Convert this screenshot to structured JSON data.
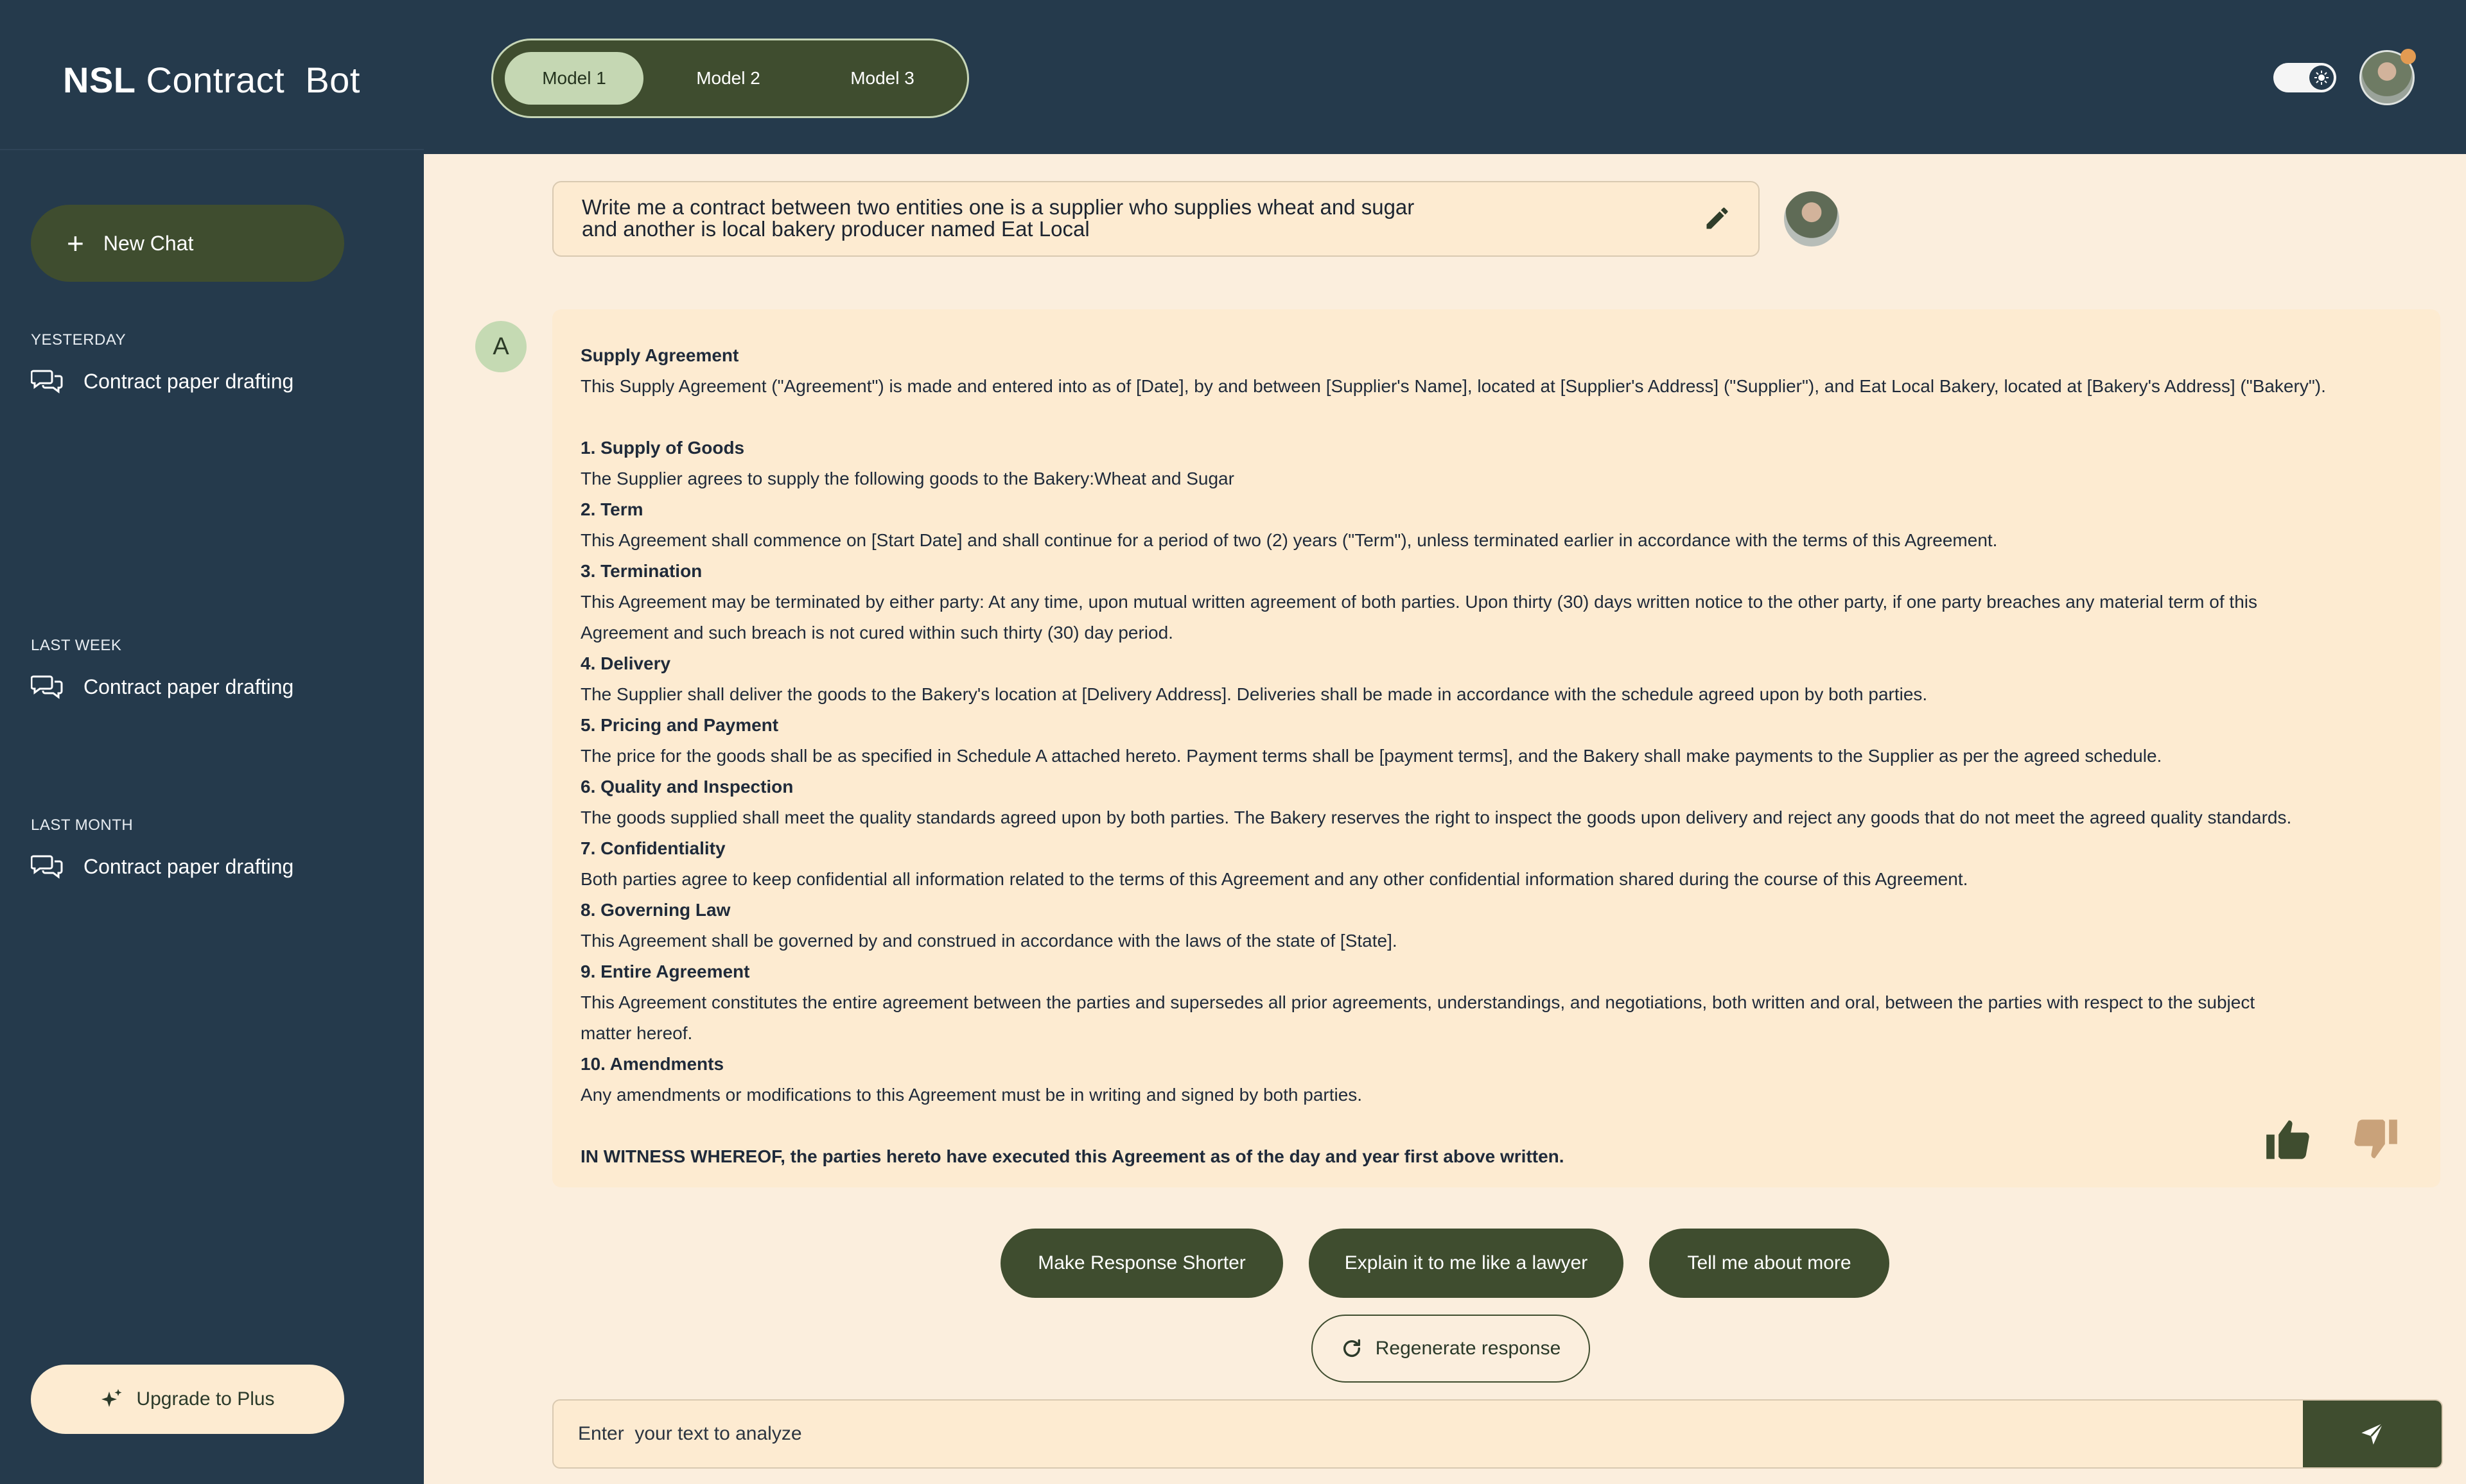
{
  "header": {
    "logo_bold": "NSL",
    "logo_rest": " Contract  Bot",
    "models": [
      "Model 1",
      "Model 2",
      "Model 3"
    ],
    "active_model": "Model 1"
  },
  "sidebar": {
    "new_chat_label": "New Chat",
    "sections": [
      {
        "label": "YESTERDAY",
        "items": [
          "Contract paper drafting"
        ]
      },
      {
        "label": "LAST WEEK",
        "items": [
          "Contract paper drafting"
        ]
      },
      {
        "label": "LAST MONTH",
        "items": [
          "Contract paper drafting"
        ]
      }
    ],
    "upgrade_label": "Upgrade to Plus"
  },
  "prompt": {
    "line1": "Write me a contract between two entities one is a supplier who supplies wheat and sugar",
    "line2": "and another is local bakery producer named Eat Local"
  },
  "assistant": {
    "avatar_letter": "A",
    "title": "Supply Agreement",
    "intro": "This Supply Agreement (\"Agreement\") is made and entered into as of [Date], by and between [Supplier's Name], located at [Supplier's Address] (\"Supplier\"), and Eat Local Bakery, located at [Bakery's Address] (\"Bakery\").",
    "sections": [
      {
        "heading": "1. Supply of Goods",
        "body": "The Supplier agrees to supply the following goods to the Bakery:Wheat and Sugar"
      },
      {
        "heading": "2. Term",
        "body": "This Agreement shall commence on [Start Date] and shall continue for a period of two (2) years (\"Term\"), unless terminated earlier in accordance with the terms of this Agreement."
      },
      {
        "heading": "3. Termination",
        "body": "This Agreement may be terminated by either party: At any time, upon mutual written agreement of both parties. Upon thirty (30) days written notice to the other party, if one party breaches any material term of this",
        "body2": "Agreement and such breach is not cured within such thirty (30) day period."
      },
      {
        "heading": "4. Delivery",
        "body": "The Supplier shall deliver the goods to the Bakery's location at [Delivery Address]. Deliveries shall be made in accordance with the schedule agreed upon by both parties."
      },
      {
        "heading": "5. Pricing and Payment",
        "body": "The price for the goods shall be as specified in Schedule A attached hereto. Payment terms shall be [payment terms], and the Bakery shall make payments to the Supplier as per the agreed schedule."
      },
      {
        "heading": "6. Quality and Inspection",
        "body": "The goods supplied shall meet the quality standards agreed upon by both parties. The Bakery reserves the right to inspect the goods upon delivery and reject any goods that do not meet the agreed quality standards."
      },
      {
        "heading": "7. Confidentiality",
        "body": "Both parties agree to keep confidential all information related to the terms of this Agreement and any other confidential information shared during the course of this Agreement."
      },
      {
        "heading": "8. Governing Law",
        "body": "This Agreement shall be governed by and construed in accordance with the laws of the state of [State]."
      },
      {
        "heading": "9. Entire Agreement",
        "body": "This Agreement constitutes the entire agreement between the parties and supersedes all prior agreements, understandings, and negotiations, both written and oral, between the parties with respect to the subject",
        "body2": "matter hereof."
      },
      {
        "heading": "10. Amendments",
        "body": "Any amendments or modifications to this Agreement must be in writing and signed by both parties."
      }
    ],
    "closing": "IN WITNESS WHEREOF, the parties hereto have executed this Agreement as of the day and year first above written."
  },
  "suggestions": [
    "Make Response Shorter",
    "Explain it to me like a lawyer",
    "Tell me about more"
  ],
  "regenerate_label": "Regenerate response",
  "input": {
    "placeholder": "Enter  your text to analyze",
    "value": ""
  },
  "icons": {
    "new_chat": "plus-icon",
    "history": "chat-bubbles-icon",
    "upgrade": "sparkle-icon",
    "edit": "pencil-icon",
    "like": "thumbs-up-icon",
    "dislike": "thumbs-down-icon",
    "regenerate": "refresh-icon",
    "send": "send-icon",
    "theme": "theme-toggle-icon"
  },
  "colors": {
    "navy": "#253a4c",
    "olive": "#3f4d2f",
    "cream": "#fdebd1",
    "page": "#fbeedd",
    "active_model": "#c5d7b3",
    "dislike": "#c9a27a"
  }
}
